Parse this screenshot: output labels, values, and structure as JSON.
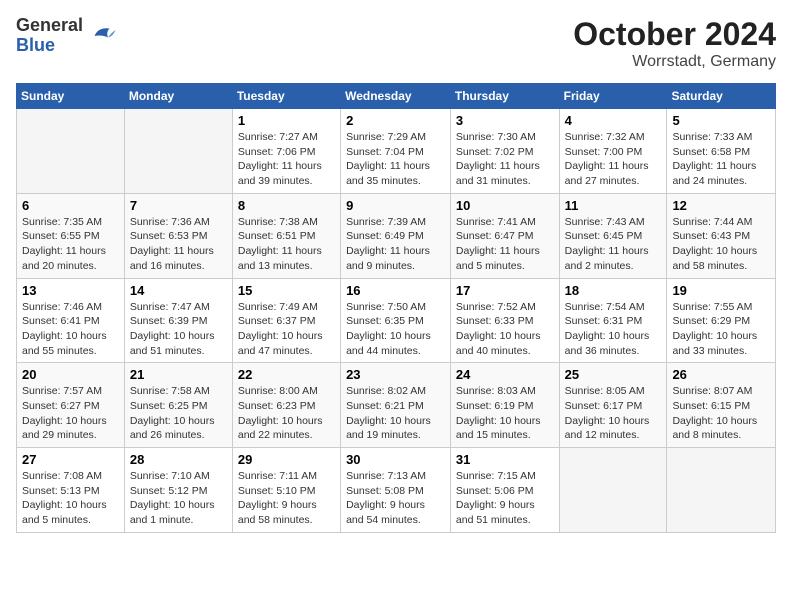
{
  "header": {
    "logo": {
      "general": "General",
      "blue": "Blue"
    },
    "title": "October 2024",
    "subtitle": "Worrstadt, Germany"
  },
  "calendar": {
    "days_of_week": [
      "Sunday",
      "Monday",
      "Tuesday",
      "Wednesday",
      "Thursday",
      "Friday",
      "Saturday"
    ],
    "weeks": [
      [
        {
          "day": "",
          "sunrise": "",
          "sunset": "",
          "daylight": ""
        },
        {
          "day": "",
          "sunrise": "",
          "sunset": "",
          "daylight": ""
        },
        {
          "day": "1",
          "sunrise": "Sunrise: 7:27 AM",
          "sunset": "Sunset: 7:06 PM",
          "daylight": "Daylight: 11 hours and 39 minutes."
        },
        {
          "day": "2",
          "sunrise": "Sunrise: 7:29 AM",
          "sunset": "Sunset: 7:04 PM",
          "daylight": "Daylight: 11 hours and 35 minutes."
        },
        {
          "day": "3",
          "sunrise": "Sunrise: 7:30 AM",
          "sunset": "Sunset: 7:02 PM",
          "daylight": "Daylight: 11 hours and 31 minutes."
        },
        {
          "day": "4",
          "sunrise": "Sunrise: 7:32 AM",
          "sunset": "Sunset: 7:00 PM",
          "daylight": "Daylight: 11 hours and 27 minutes."
        },
        {
          "day": "5",
          "sunrise": "Sunrise: 7:33 AM",
          "sunset": "Sunset: 6:58 PM",
          "daylight": "Daylight: 11 hours and 24 minutes."
        }
      ],
      [
        {
          "day": "6",
          "sunrise": "Sunrise: 7:35 AM",
          "sunset": "Sunset: 6:55 PM",
          "daylight": "Daylight: 11 hours and 20 minutes."
        },
        {
          "day": "7",
          "sunrise": "Sunrise: 7:36 AM",
          "sunset": "Sunset: 6:53 PM",
          "daylight": "Daylight: 11 hours and 16 minutes."
        },
        {
          "day": "8",
          "sunrise": "Sunrise: 7:38 AM",
          "sunset": "Sunset: 6:51 PM",
          "daylight": "Daylight: 11 hours and 13 minutes."
        },
        {
          "day": "9",
          "sunrise": "Sunrise: 7:39 AM",
          "sunset": "Sunset: 6:49 PM",
          "daylight": "Daylight: 11 hours and 9 minutes."
        },
        {
          "day": "10",
          "sunrise": "Sunrise: 7:41 AM",
          "sunset": "Sunset: 6:47 PM",
          "daylight": "Daylight: 11 hours and 5 minutes."
        },
        {
          "day": "11",
          "sunrise": "Sunrise: 7:43 AM",
          "sunset": "Sunset: 6:45 PM",
          "daylight": "Daylight: 11 hours and 2 minutes."
        },
        {
          "day": "12",
          "sunrise": "Sunrise: 7:44 AM",
          "sunset": "Sunset: 6:43 PM",
          "daylight": "Daylight: 10 hours and 58 minutes."
        }
      ],
      [
        {
          "day": "13",
          "sunrise": "Sunrise: 7:46 AM",
          "sunset": "Sunset: 6:41 PM",
          "daylight": "Daylight: 10 hours and 55 minutes."
        },
        {
          "day": "14",
          "sunrise": "Sunrise: 7:47 AM",
          "sunset": "Sunset: 6:39 PM",
          "daylight": "Daylight: 10 hours and 51 minutes."
        },
        {
          "day": "15",
          "sunrise": "Sunrise: 7:49 AM",
          "sunset": "Sunset: 6:37 PM",
          "daylight": "Daylight: 10 hours and 47 minutes."
        },
        {
          "day": "16",
          "sunrise": "Sunrise: 7:50 AM",
          "sunset": "Sunset: 6:35 PM",
          "daylight": "Daylight: 10 hours and 44 minutes."
        },
        {
          "day": "17",
          "sunrise": "Sunrise: 7:52 AM",
          "sunset": "Sunset: 6:33 PM",
          "daylight": "Daylight: 10 hours and 40 minutes."
        },
        {
          "day": "18",
          "sunrise": "Sunrise: 7:54 AM",
          "sunset": "Sunset: 6:31 PM",
          "daylight": "Daylight: 10 hours and 36 minutes."
        },
        {
          "day": "19",
          "sunrise": "Sunrise: 7:55 AM",
          "sunset": "Sunset: 6:29 PM",
          "daylight": "Daylight: 10 hours and 33 minutes."
        }
      ],
      [
        {
          "day": "20",
          "sunrise": "Sunrise: 7:57 AM",
          "sunset": "Sunset: 6:27 PM",
          "daylight": "Daylight: 10 hours and 29 minutes."
        },
        {
          "day": "21",
          "sunrise": "Sunrise: 7:58 AM",
          "sunset": "Sunset: 6:25 PM",
          "daylight": "Daylight: 10 hours and 26 minutes."
        },
        {
          "day": "22",
          "sunrise": "Sunrise: 8:00 AM",
          "sunset": "Sunset: 6:23 PM",
          "daylight": "Daylight: 10 hours and 22 minutes."
        },
        {
          "day": "23",
          "sunrise": "Sunrise: 8:02 AM",
          "sunset": "Sunset: 6:21 PM",
          "daylight": "Daylight: 10 hours and 19 minutes."
        },
        {
          "day": "24",
          "sunrise": "Sunrise: 8:03 AM",
          "sunset": "Sunset: 6:19 PM",
          "daylight": "Daylight: 10 hours and 15 minutes."
        },
        {
          "day": "25",
          "sunrise": "Sunrise: 8:05 AM",
          "sunset": "Sunset: 6:17 PM",
          "daylight": "Daylight: 10 hours and 12 minutes."
        },
        {
          "day": "26",
          "sunrise": "Sunrise: 8:07 AM",
          "sunset": "Sunset: 6:15 PM",
          "daylight": "Daylight: 10 hours and 8 minutes."
        }
      ],
      [
        {
          "day": "27",
          "sunrise": "Sunrise: 7:08 AM",
          "sunset": "Sunset: 5:13 PM",
          "daylight": "Daylight: 10 hours and 5 minutes."
        },
        {
          "day": "28",
          "sunrise": "Sunrise: 7:10 AM",
          "sunset": "Sunset: 5:12 PM",
          "daylight": "Daylight: 10 hours and 1 minute."
        },
        {
          "day": "29",
          "sunrise": "Sunrise: 7:11 AM",
          "sunset": "Sunset: 5:10 PM",
          "daylight": "Daylight: 9 hours and 58 minutes."
        },
        {
          "day": "30",
          "sunrise": "Sunrise: 7:13 AM",
          "sunset": "Sunset: 5:08 PM",
          "daylight": "Daylight: 9 hours and 54 minutes."
        },
        {
          "day": "31",
          "sunrise": "Sunrise: 7:15 AM",
          "sunset": "Sunset: 5:06 PM",
          "daylight": "Daylight: 9 hours and 51 minutes."
        },
        {
          "day": "",
          "sunrise": "",
          "sunset": "",
          "daylight": ""
        },
        {
          "day": "",
          "sunrise": "",
          "sunset": "",
          "daylight": ""
        }
      ]
    ]
  }
}
